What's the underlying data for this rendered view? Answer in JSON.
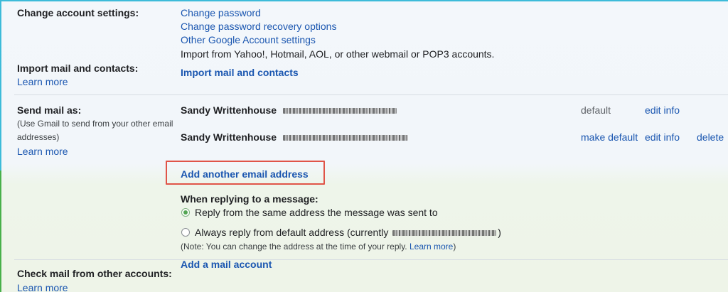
{
  "account": {
    "label": "Change account settings:",
    "links": [
      "Change password",
      "Change password recovery options",
      "Other Google Account settings"
    ]
  },
  "import": {
    "label": "Import mail and contacts:",
    "learn_more": "Learn more",
    "description": "Import from Yahoo!, Hotmail, AOL, or other webmail or POP3 accounts.",
    "action": "Import mail and contacts"
  },
  "send_as": {
    "label": "Send mail as:",
    "help_line1": "(Use Gmail to send from your other email",
    "help_line2": "addresses)",
    "learn_more": "Learn more",
    "rows": [
      {
        "name": "Sandy Writtenhouse",
        "status": "default",
        "edit": "edit info"
      },
      {
        "name": "Sandy Writtenhouse",
        "make_default": "make default",
        "edit": "edit info",
        "delete": "delete"
      }
    ],
    "add_address": "Add another email address",
    "reply_heading": "When replying to a message:",
    "reply_option_1": "Reply from the same address the message was sent to",
    "reply_option_2": "Always reply from default address (currently",
    "reply_option_2_close": ")",
    "note": "(Note: You can change the address at the time of your reply.",
    "note_link": "Learn more",
    "note_close": ")",
    "selected_option": 1
  },
  "check_mail": {
    "label": "Check mail from other accounts:",
    "learn_more": "Learn more",
    "action": "Add a mail account"
  },
  "icons": {
    "radio_selected": "radio-selected-icon",
    "radio_unselected": "radio-unselected-icon"
  },
  "colors": {
    "link": "#1a56b0",
    "highlight": "#e05448",
    "radio_selected": "#53a653"
  }
}
